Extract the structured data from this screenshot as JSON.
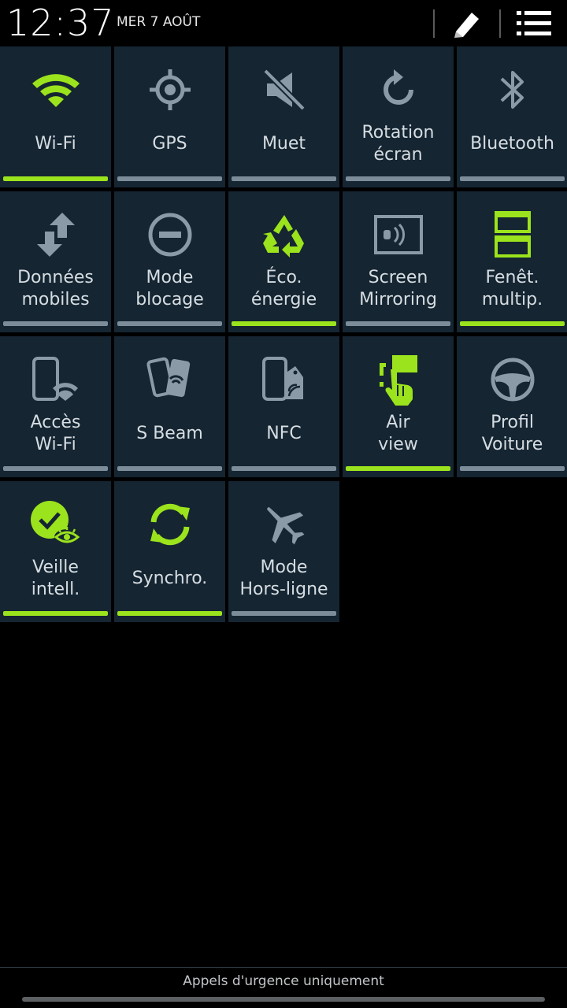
{
  "status": {
    "time": "12:37",
    "date": "MER 7 AOÛT"
  },
  "header": {
    "edit_icon": "pencil-icon",
    "menu_icon": "list-icon"
  },
  "colors": {
    "active": "#9be31c",
    "inactive": "#7c8d99",
    "tile_bg": "#152532",
    "icon_grey": "#8a9aa6"
  },
  "tiles": [
    {
      "label": "Wi-Fi",
      "icon": "wifi-icon",
      "active": true
    },
    {
      "label": "GPS",
      "icon": "gps-icon",
      "active": false
    },
    {
      "label": "Muet",
      "icon": "mute-icon",
      "active": false
    },
    {
      "label": "Rotation\nécran",
      "icon": "rotation-icon",
      "active": false
    },
    {
      "label": "Bluetooth",
      "icon": "bluetooth-icon",
      "active": false
    },
    {
      "label": "Données\nmobiles",
      "icon": "mobile-data-icon",
      "active": false
    },
    {
      "label": "Mode\nblocage",
      "icon": "block-icon",
      "active": false
    },
    {
      "label": "Éco.\nénergie",
      "icon": "recycle-icon",
      "active": true
    },
    {
      "label": "Screen\nMirroring",
      "icon": "screen-mirroring-icon",
      "active": false
    },
    {
      "label": "Fenêt.\nmultip.",
      "icon": "multi-window-icon",
      "active": true
    },
    {
      "label": "Accès\nWi-Fi",
      "icon": "wifi-hotspot-icon",
      "active": false
    },
    {
      "label": "S Beam",
      "icon": "s-beam-icon",
      "active": false
    },
    {
      "label": "NFC",
      "icon": "nfc-icon",
      "active": false
    },
    {
      "label": "Air\nview",
      "icon": "air-view-icon",
      "active": true
    },
    {
      "label": "Profil\nVoiture",
      "icon": "steering-wheel-icon",
      "active": false
    },
    {
      "label": "Veille\nintell.",
      "icon": "smart-stay-icon",
      "active": true
    },
    {
      "label": "Synchro.",
      "icon": "sync-icon",
      "active": true
    },
    {
      "label": "Mode\nHors-ligne",
      "icon": "airplane-icon",
      "active": false
    }
  ],
  "footer": {
    "text": "Appels d'urgence uniquement"
  }
}
